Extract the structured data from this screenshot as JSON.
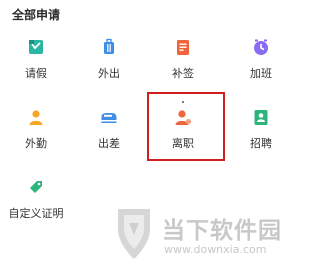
{
  "page": {
    "section_title": "全部申请"
  },
  "apps": [
    {
      "label": "请假",
      "icon": "calendar-leave-icon",
      "color": "#2bb5a3"
    },
    {
      "label": "外出",
      "icon": "luggage-icon",
      "color": "#3e8ee8"
    },
    {
      "label": "补签",
      "icon": "document-icon",
      "color": "#f2643c"
    },
    {
      "label": "加班",
      "icon": "clock-icon",
      "color": "#8a6cf0"
    },
    {
      "label": "外勤",
      "icon": "field-person-icon",
      "color": "#f5a623"
    },
    {
      "label": "出差",
      "icon": "train-icon",
      "color": "#3e8ee8"
    },
    {
      "label": "离职",
      "icon": "resign-person-icon",
      "color": "#f2643c"
    },
    {
      "label": "招聘",
      "icon": "recruit-icon",
      "color": "#2bb57a"
    },
    {
      "label": "自定义证明",
      "icon": "tag-icon",
      "color": "#2bb57a"
    }
  ],
  "highlight": {
    "target": "离职",
    "color": "#d0201d"
  },
  "watermark": {
    "name": "当下软件园",
    "url": "www.downxia.com"
  }
}
